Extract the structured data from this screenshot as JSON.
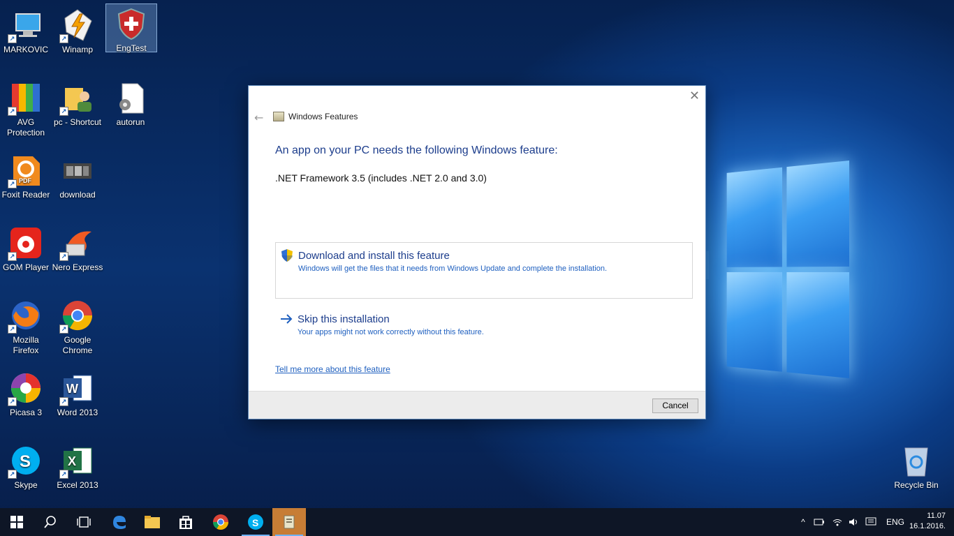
{
  "desktop": {
    "icons": [
      {
        "label": "MARKOVIC",
        "icon": "computer-icon"
      },
      {
        "label": "Winamp",
        "icon": "winamp-icon"
      },
      {
        "label": "EngTest",
        "icon": "shield-icon"
      },
      {
        "label": "AVG\nProtection",
        "icon": "avg-icon"
      },
      {
        "label": "pc - Shortcut",
        "icon": "folder-user-icon"
      },
      {
        "label": "autorun",
        "icon": "settings-file-icon"
      },
      {
        "label": "Foxit Reader",
        "icon": "foxit-icon"
      },
      {
        "label": "download",
        "icon": "video-file-icon"
      },
      {
        "label": "GOM Player",
        "icon": "gom-icon"
      },
      {
        "label": "Nero Express",
        "icon": "nero-icon"
      },
      {
        "label": "Mozilla\nFirefox",
        "icon": "firefox-icon"
      },
      {
        "label": "Google\nChrome",
        "icon": "chrome-icon"
      },
      {
        "label": "Picasa 3",
        "icon": "picasa-icon"
      },
      {
        "label": "Word 2013",
        "icon": "word-icon"
      },
      {
        "label": "Skype",
        "icon": "skype-icon"
      },
      {
        "label": "Excel 2013",
        "icon": "excel-icon"
      },
      {
        "label": "Recycle Bin",
        "icon": "recycle-bin-icon"
      }
    ]
  },
  "dialog": {
    "title": "Windows Features",
    "heading": "An app on your PC needs the following Windows feature:",
    "feature": ".NET Framework 3.5 (includes .NET 2.0 and 3.0)",
    "option1": {
      "title": "Download and install this feature",
      "desc": "Windows will get the files that it needs from Windows Update and complete the installation."
    },
    "option2": {
      "title": "Skip this installation",
      "desc": "Your apps might not work correctly without this feature."
    },
    "link": "Tell me more about this feature",
    "cancel": "Cancel",
    "close_glyph": "✕",
    "back_glyph": "←"
  },
  "taskbar": {
    "items": [
      "start-icon",
      "search-icon",
      "task-view-icon",
      "edge-icon",
      "file-explorer-icon",
      "store-icon",
      "chrome-icon",
      "skype-icon",
      "windows-features-icon"
    ],
    "language": "ENG",
    "time": "11.07",
    "date": "16.1.2016."
  },
  "colors": {
    "accent": "#1c3d8c",
    "link": "#1e5fbf",
    "taskbar": "#0e1626",
    "active": "#c77d35"
  }
}
